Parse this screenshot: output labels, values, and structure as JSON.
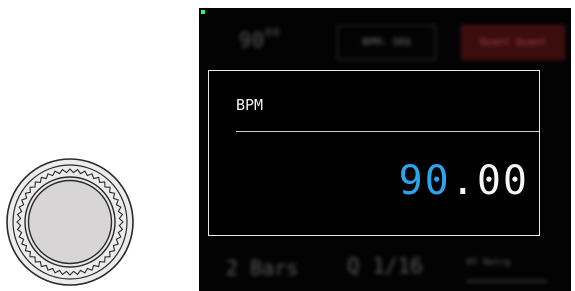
{
  "knob": {
    "icon": "rotary-encoder-icon"
  },
  "screen": {
    "top_bar": {
      "bpm_display": "90",
      "bpm_display_sup": "00",
      "bpm_seq_chip": "BPM: SEQ",
      "quantize_chip": "Quant Quant"
    },
    "dialog": {
      "title": "BPM",
      "value_integer": "90",
      "value_dot": ".",
      "value_decimal": "00"
    },
    "bottom_bar": {
      "bars": "2 Bars",
      "quantize": "Q 1/16",
      "retrig": "RT Retrg"
    }
  },
  "colors": {
    "accent": "#2aa6ee",
    "led": "#2ef07a",
    "screen_bg": "#030303"
  }
}
